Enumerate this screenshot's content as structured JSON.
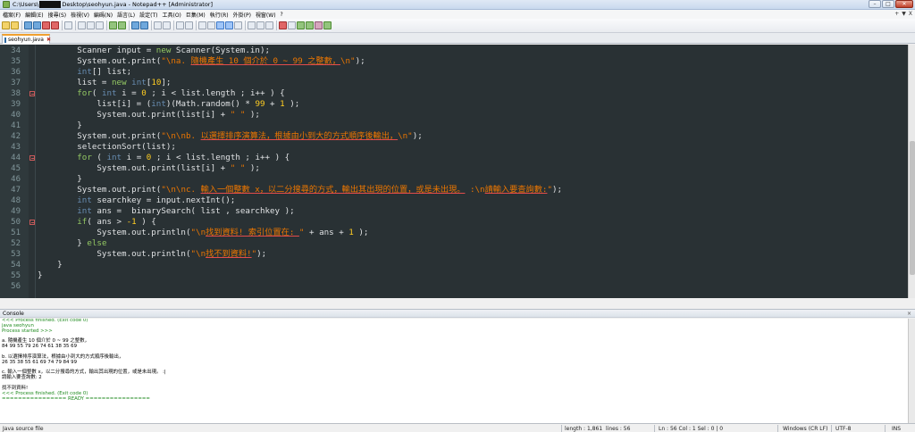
{
  "window": {
    "title_prefix": "C:\\Users\\",
    "title_suffix": "Desktop\\seohyun.java - Notepad++ [Administrator]",
    "controls": [
      "–",
      "□",
      "✕"
    ]
  },
  "menu": {
    "items": [
      "檔案(F)",
      "編輯(E)",
      "搜尋(S)",
      "檢視(V)",
      "編碼(N)",
      "語言(L)",
      "設定(T)",
      "工具(O)",
      "巨集(M)",
      "執行(R)",
      "外掛(P)",
      "視窗(W)",
      "?"
    ],
    "right": [
      "+",
      "▼",
      "X"
    ]
  },
  "toolbar": {
    "icons": [
      "new-file-icon",
      "open-file-icon",
      "save-icon",
      "save-all-icon",
      "close-icon",
      "close-all-icon",
      "print-icon",
      "cut-icon",
      "copy-icon",
      "paste-icon",
      "undo-icon",
      "redo-icon",
      "find-icon",
      "replace-icon",
      "zoom-in-icon",
      "zoom-out-icon",
      "sync-v-icon",
      "sync-h-icon",
      "wrap-icon",
      "all-chars-icon",
      "indent-guide-icon",
      "udl-icon",
      "doc-map-icon",
      "function-list-icon",
      "folder-workspace-icon",
      "monitoring-icon",
      "record-macro-icon",
      "stop-record-icon",
      "play-macro-icon",
      "play-multi-icon",
      "save-macro-icon",
      "run-icon"
    ]
  },
  "tab": {
    "label": "seohyun.java",
    "close": "✖"
  },
  "editor": {
    "lines": [
      {
        "n": "34",
        "fold": false,
        "indent": "        ",
        "parts": [
          [
            "",
            "Scanner input = "
          ],
          [
            "kw",
            "new"
          ],
          [
            "",
            " Scanner(System.in);"
          ]
        ]
      },
      {
        "n": "35",
        "fold": false,
        "indent": "        ",
        "parts": [
          [
            "",
            "System.out.print("
          ],
          [
            "st",
            "\"\\na. "
          ],
          [
            "stc",
            "隨機產生 10 個介於 0 ~ 99 之整數，"
          ],
          [
            "st",
            "\\n\""
          ],
          [
            "",
            ");"
          ]
        ]
      },
      {
        "n": "36",
        "fold": false,
        "indent": "        ",
        "parts": [
          [
            "ty",
            "int"
          ],
          [
            "",
            "[] list;"
          ]
        ]
      },
      {
        "n": "37",
        "fold": false,
        "indent": "        ",
        "parts": [
          [
            "",
            "list = "
          ],
          [
            "kw",
            "new"
          ],
          [
            "",
            " "
          ],
          [
            "ty",
            "int"
          ],
          [
            "",
            "["
          ],
          [
            "nm",
            "10"
          ],
          [
            "",
            "];"
          ]
        ]
      },
      {
        "n": "38",
        "fold": true,
        "indent": "        ",
        "parts": [
          [
            "kw",
            "for"
          ],
          [
            "",
            "( "
          ],
          [
            "ty",
            "int"
          ],
          [
            "",
            " i = "
          ],
          [
            "nm",
            "0"
          ],
          [
            "",
            " ; i < list.length ; i++ ) {"
          ]
        ]
      },
      {
        "n": "39",
        "fold": false,
        "indent": "            ",
        "parts": [
          [
            "",
            "list[i] = ("
          ],
          [
            "ty",
            "int"
          ],
          [
            "",
            ")(Math.random() * "
          ],
          [
            "nm",
            "99"
          ],
          [
            "",
            " + "
          ],
          [
            "nm",
            "1"
          ],
          [
            "",
            " );"
          ]
        ]
      },
      {
        "n": "40",
        "fold": false,
        "indent": "            ",
        "parts": [
          [
            "",
            "System.out.print(list[i] + "
          ],
          [
            "st",
            "\" \""
          ],
          [
            "",
            " );"
          ]
        ]
      },
      {
        "n": "41",
        "fold": false,
        "indent": "        ",
        "parts": [
          [
            "",
            "}"
          ]
        ]
      },
      {
        "n": "42",
        "fold": false,
        "indent": "        ",
        "parts": [
          [
            "",
            "System.out.print("
          ],
          [
            "st",
            "\"\\n\\nb. "
          ],
          [
            "stc",
            "以選擇排序演算法，根據由小到大的方式順序後輸出，"
          ],
          [
            "st",
            "\\n\""
          ],
          [
            "",
            ");"
          ]
        ]
      },
      {
        "n": "43",
        "fold": false,
        "indent": "        ",
        "parts": [
          [
            "",
            "selectionSort(list);"
          ]
        ]
      },
      {
        "n": "44",
        "fold": true,
        "indent": "        ",
        "parts": [
          [
            "kw",
            "for"
          ],
          [
            "",
            " ( "
          ],
          [
            "ty",
            "int"
          ],
          [
            "",
            " i = "
          ],
          [
            "nm",
            "0"
          ],
          [
            "",
            " ; i < list.length ; i++ ) {"
          ]
        ]
      },
      {
        "n": "45",
        "fold": false,
        "indent": "            ",
        "parts": [
          [
            "",
            "System.out.print(list[i] + "
          ],
          [
            "st",
            "\" \""
          ],
          [
            "",
            " );"
          ]
        ]
      },
      {
        "n": "46",
        "fold": false,
        "indent": "        ",
        "parts": [
          [
            "",
            "}"
          ]
        ]
      },
      {
        "n": "47",
        "fold": false,
        "indent": "        ",
        "parts": [
          [
            "",
            "System.out.print("
          ],
          [
            "st",
            "\"\\n\\nc. "
          ],
          [
            "stc",
            "輸入一個整數 x，以二分搜尋的方式，輸出其出現的位置，或是未出現。"
          ],
          [
            "st",
            " :\\n"
          ],
          [
            "stc",
            "請輸入要查詢數:"
          ],
          [
            "st",
            "\""
          ],
          [
            "",
            ");"
          ]
        ]
      },
      {
        "n": "48",
        "fold": false,
        "indent": "        ",
        "parts": [
          [
            "ty",
            "int"
          ],
          [
            "",
            " searchkey = input.nextInt();"
          ]
        ]
      },
      {
        "n": "49",
        "fold": false,
        "indent": "        ",
        "parts": [
          [
            "ty",
            "int"
          ],
          [
            "",
            " ans =  binarySearch( list , searchkey );"
          ]
        ]
      },
      {
        "n": "50",
        "fold": true,
        "indent": "        ",
        "parts": [
          [
            "kw",
            "if"
          ],
          [
            "",
            "( ans > "
          ],
          [
            "nm",
            "-1"
          ],
          [
            "",
            " ) {"
          ]
        ]
      },
      {
        "n": "51",
        "fold": false,
        "indent": "            ",
        "parts": [
          [
            "",
            "System.out.println("
          ],
          [
            "st",
            "\"\\n"
          ],
          [
            "stc",
            "找到資料! 索引位置在: "
          ],
          [
            "st",
            "\""
          ],
          [
            "",
            " + ans + "
          ],
          [
            "nm",
            "1"
          ],
          [
            "",
            " );"
          ]
        ]
      },
      {
        "n": "52",
        "fold": false,
        "indent": "        ",
        "parts": [
          [
            "",
            "} "
          ],
          [
            "kw",
            "else"
          ]
        ]
      },
      {
        "n": "53",
        "fold": false,
        "indent": "            ",
        "parts": [
          [
            "",
            "System.out.println("
          ],
          [
            "st",
            "\"\\n"
          ],
          [
            "stc",
            "找不到資料!"
          ],
          [
            "st",
            "\""
          ],
          [
            "",
            ");"
          ]
        ]
      },
      {
        "n": "54",
        "fold": false,
        "indent": "    ",
        "parts": [
          [
            "",
            "}"
          ]
        ]
      },
      {
        "n": "55",
        "fold": false,
        "indent": "",
        "parts": [
          [
            "",
            "}"
          ]
        ]
      },
      {
        "n": "56",
        "fold": false,
        "indent": "",
        "parts": []
      }
    ]
  },
  "console": {
    "title": "Console",
    "close": "×",
    "lines": [
      {
        "text": "<<< Process finished. (Exit code 0)",
        "green": true
      },
      {
        "text": "java seohyun",
        "green": true
      },
      {
        "text": "Process started >>>",
        "green": true
      },
      {
        "text": "",
        "green": false
      },
      {
        "text": "a. 隨機產生 10 個介於 0 ~ 99 之整數，",
        "green": false
      },
      {
        "text": "84 99 55 79 26 74 61 38 35 69",
        "green": false
      },
      {
        "text": "",
        "green": false
      },
      {
        "text": "b. 以選擇排序演算法，根據由小到大的方式順序後輸出，",
        "green": false
      },
      {
        "text": "26 35 38 55 61 69 74 79 84 99",
        "green": false
      },
      {
        "text": "",
        "green": false
      },
      {
        "text": "c. 輸入一個整數 x，以二分搜尋的方式，輸出其出現的位置，或是未出現。 :|",
        "green": false
      },
      {
        "text": "請輸入要查詢數: 2",
        "green": false
      },
      {
        "text": "",
        "green": false
      },
      {
        "text": "找不到資料!",
        "green": false
      },
      {
        "text": "<<< Process finished. (Exit code 0)",
        "green": true
      },
      {
        "text": "================ READY ================",
        "green": true
      }
    ]
  },
  "status": {
    "file_type": "Java source file",
    "length": "length : 1,861",
    "lines": "lines : 56",
    "position": "Ln : 56   Col : 1   Sel : 0 | 0",
    "eol": "Windows (CR LF)",
    "encoding": "UTF-8",
    "mode": "INS"
  }
}
